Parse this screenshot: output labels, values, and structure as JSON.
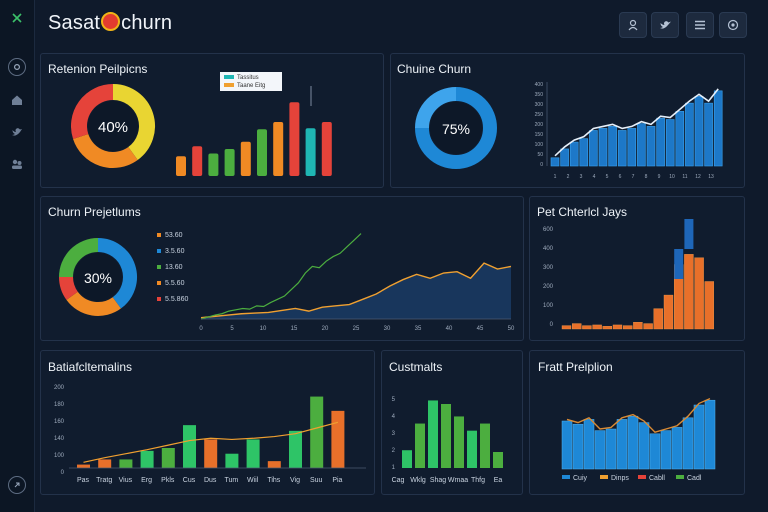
{
  "app": {
    "title_pre": "Sasat",
    "title_post": "churn"
  },
  "icons": {
    "sidebar": [
      "close-icon",
      "settings-icon",
      "home-icon",
      "twitter-icon",
      "users-icon",
      "expand-icon"
    ],
    "topbar": [
      "profile-icon",
      "twitter-icon",
      "menu-icon",
      "support-icon"
    ]
  },
  "panels": {
    "retention": {
      "title": "Retenion Peilpicns",
      "donut_label": "40%",
      "legend": [
        "Tassitus",
        "Taane Eitg"
      ]
    },
    "churn_top": {
      "title": "Chuine Churn",
      "donut_label": "75%"
    },
    "churn_pred": {
      "title": "Churn Prejetlums",
      "donut_label": "30%",
      "legend": [
        "53.60",
        "3.5.60",
        "13.60",
        "5.5.60",
        "5.5.860"
      ]
    },
    "pet": {
      "title": "Pet Chterlcl Jays"
    },
    "bottom_left": {
      "title": "Batiafcltemalins"
    },
    "customs": {
      "title": "Custmalts"
    },
    "fratt": {
      "title": "Fratt Prelplion",
      "legend": [
        "Cuiy",
        "Dinps",
        "Cabll",
        "Cadl"
      ]
    }
  },
  "colors": {
    "bg": "#0f1a2b",
    "panel": "#101c2e",
    "blue": "#1e88d6",
    "orange": "#f08a24",
    "red": "#e5433a",
    "green": "#4cae3f",
    "yellow": "#e9d532",
    "teal": "#1fb6b4"
  },
  "chart_data": [
    {
      "type": "pie",
      "title": "Retenion Peilpicns",
      "label": "40%",
      "slices": [
        {
          "color": "#e9d532",
          "value": 40
        },
        {
          "color": "#f08a24",
          "value": 30
        },
        {
          "color": "#e5433a",
          "value": 30
        }
      ]
    },
    {
      "type": "bar",
      "title": "Retenion Peilpicns",
      "values": [
        22,
        33,
        25,
        30,
        38,
        52,
        60,
        82,
        53,
        60
      ],
      "colors": [
        "#f08a24",
        "#e5433a",
        "#4cae3f",
        "#4cae3f",
        "#f08a24",
        "#4cae3f",
        "#f08a24",
        "#e5433a",
        "#1fb6b4",
        "#e5433a"
      ],
      "ylim": [
        0,
        100
      ]
    },
    {
      "type": "pie",
      "title": "Chuine Churn",
      "label": "75%",
      "slices": [
        {
          "color": "#1e88d6",
          "value": 75
        },
        {
          "color": "#3ea4ec",
          "value": 25
        }
      ]
    },
    {
      "type": "bar",
      "title": "Chuine Churn",
      "yticks": [
        "400",
        "350",
        "300",
        "250",
        "200",
        "150",
        "100",
        "50",
        "0"
      ],
      "values": [
        12,
        25,
        35,
        40,
        52,
        55,
        58,
        52,
        55,
        62,
        58,
        70,
        68,
        80,
        92,
        102,
        92,
        110
      ],
      "ylim": [
        0,
        120
      ]
    },
    {
      "type": "pie",
      "title": "Churn Prejetlums",
      "label": "30%",
      "slices": [
        {
          "color": "#1e88d6",
          "value": 40
        },
        {
          "color": "#f08a24",
          "value": 25
        },
        {
          "color": "#e5433a",
          "value": 10
        },
        {
          "color": "#4cae3f",
          "value": 25
        }
      ]
    },
    {
      "type": "area",
      "title": "Churn Prejetlums",
      "xticks": [
        "0",
        "5",
        "10",
        "15",
        "20",
        "25",
        "30",
        "35",
        "40",
        "45",
        "50"
      ],
      "series": [
        {
          "color": "#f0a030",
          "values": [
            2,
            4,
            6,
            8,
            9,
            10,
            13,
            16,
            12,
            18,
            20,
            22,
            30,
            38,
            50,
            60,
            68,
            62,
            70,
            72,
            62,
            85,
            76,
            80
          ]
        },
        {
          "color": "#4cae3f",
          "values": [
            0,
            3,
            6,
            8,
            12,
            14,
            16,
            15,
            20,
            19,
            25,
            30,
            35,
            45,
            55,
            70,
            80,
            78,
            88,
            95,
            100,
            110,
            120,
            130
          ]
        }
      ],
      "ylim": [
        0,
        140
      ]
    },
    {
      "type": "bar",
      "title": "Pet Chterlcl Jays",
      "yticks": [
        "600",
        "400",
        "300",
        "200",
        "100",
        "0"
      ],
      "values": [
        5,
        8,
        5,
        6,
        4,
        6,
        5,
        10,
        8,
        30,
        50,
        95,
        110,
        105,
        70
      ],
      "colors": [
        "#e8702a",
        "#e8702a",
        "#e8702a",
        "#e8702a",
        "#e8702a",
        "#e8702a",
        "#e8702a",
        "#e8702a",
        "#e8702a",
        "#e8702a",
        "#e8702a",
        "#e8702a",
        "#e8702a",
        "#e8702a",
        "#e8702a"
      ],
      "ylim": [
        0,
        140
      ]
    },
    {
      "type": "bar",
      "title": "Batiafcltemalins",
      "categories": [
        "Pas",
        "Tratg",
        "Vius",
        "Erg",
        "Pkls",
        "Cus",
        "Dus",
        "Tum",
        "Wiil",
        "Tihs",
        "Vig",
        "Suu",
        "Pia"
      ],
      "yticks": [
        "200",
        "180",
        "160",
        "140",
        "100",
        "0"
      ],
      "values": [
        6,
        15,
        15,
        30,
        35,
        75,
        50,
        25,
        50,
        12,
        65,
        125,
        100
      ],
      "colors": [
        "#e8702a",
        "#e8702a",
        "#4cae3f",
        "#2ec467",
        "#4cae3f",
        "#2ec467",
        "#e8702a",
        "#2ec467",
        "#2ec467",
        "#e8702a",
        "#2ec467",
        "#4cae3f",
        "#e8702a"
      ],
      "line": [
        10,
        18,
        25,
        32,
        40,
        48,
        52,
        50,
        52,
        55,
        60,
        70,
        80
      ],
      "ylim": [
        0,
        140
      ]
    },
    {
      "type": "bar",
      "title": "Custmalts",
      "categories": [
        "Cag",
        "Wklg",
        "Shag",
        "Wmaa",
        "Thfg",
        "Ea"
      ],
      "yticks": [
        "5",
        "4",
        "3",
        "2",
        "1"
      ],
      "values": [
        20,
        50,
        76,
        72,
        58,
        42,
        50,
        18
      ],
      "colors": [
        "#2ec467",
        "#4cae3f",
        "#2ec467",
        "#4cae3f",
        "#4cae3f",
        "#2ec467",
        "#4cae3f",
        "#4cae3f"
      ],
      "ylim": [
        0,
        90
      ]
    },
    {
      "type": "bar",
      "title": "Fratt Prelplion",
      "values": [
        60,
        56,
        62,
        48,
        50,
        62,
        66,
        58,
        44,
        48,
        52,
        64,
        80,
        86
      ],
      "line": [
        62,
        58,
        64,
        50,
        52,
        64,
        68,
        60,
        46,
        50,
        54,
        66,
        82,
        88
      ],
      "ylim": [
        0,
        100
      ]
    }
  ]
}
